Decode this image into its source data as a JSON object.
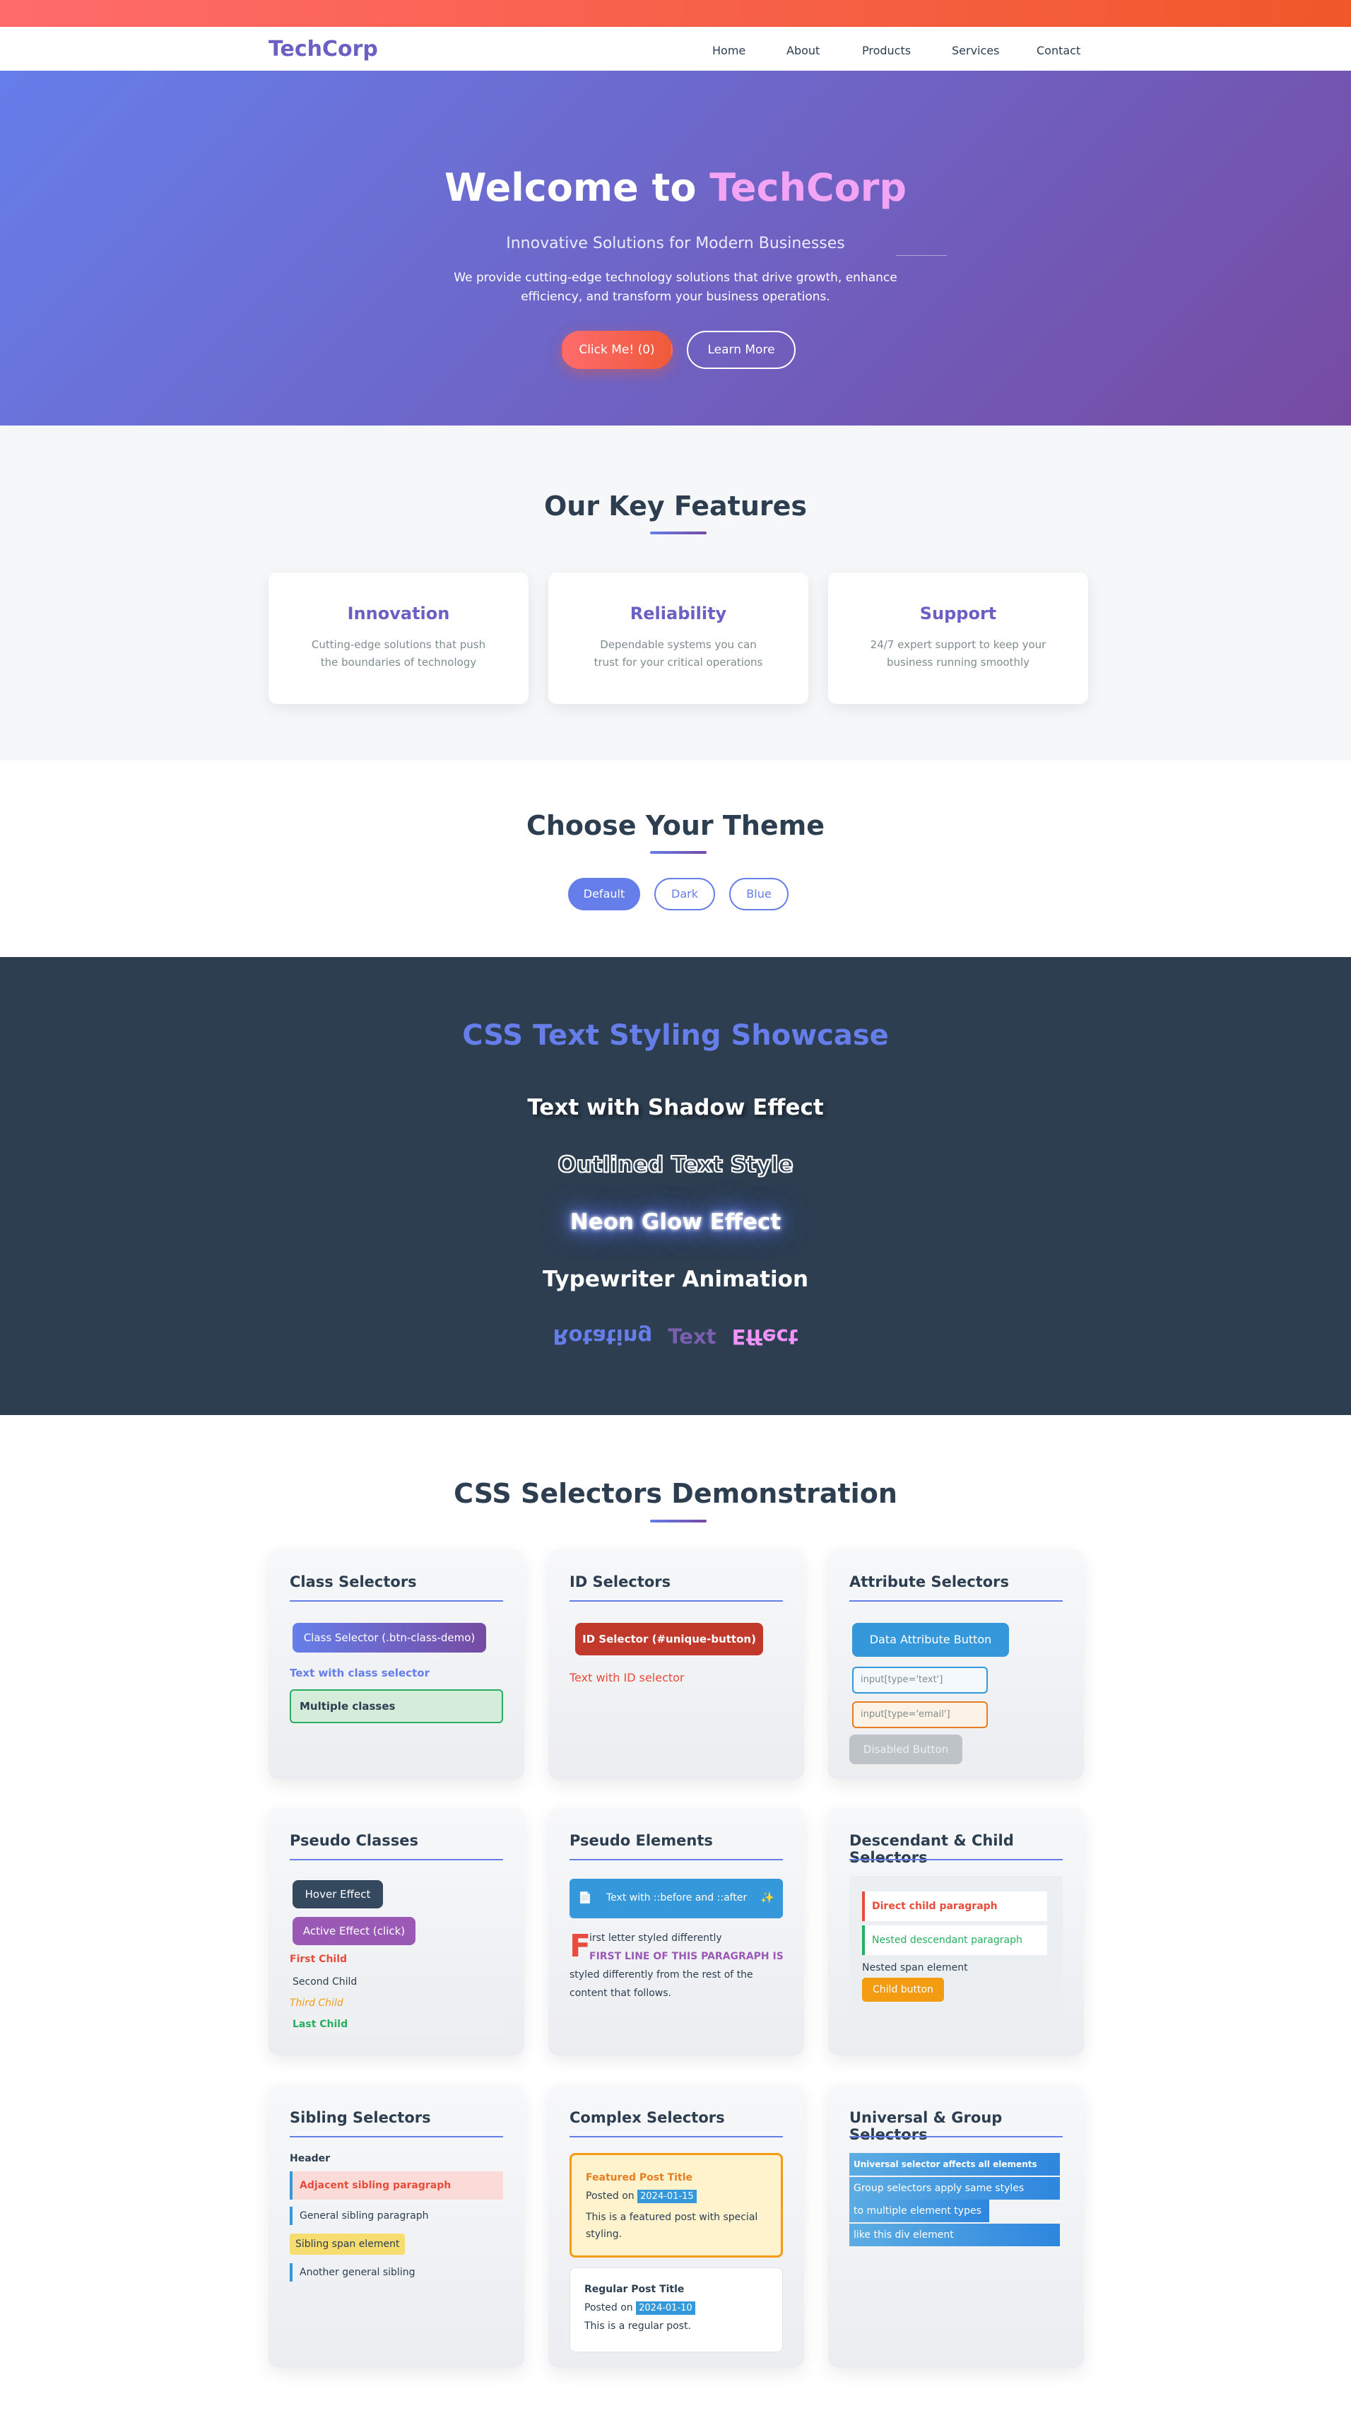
{
  "nav": {
    "logo": "TechCorp",
    "links": [
      "Home",
      "About",
      "Products",
      "Services",
      "Contact"
    ]
  },
  "hero": {
    "title_prefix": "Welcome to ",
    "title_brand": "TechCorp",
    "subtitle": "Innovative Solutions for Modern Businesses",
    "description": "We provide cutting-edge technology solutions that drive growth, enhance efficiency, and transform your business operations.",
    "primary_button": "Click Me! (0)",
    "secondary_button": "Learn More"
  },
  "features": {
    "title": "Our Key Features",
    "cards": [
      {
        "title": "Innovation",
        "text": "Cutting-edge solutions that push the boundaries of technology"
      },
      {
        "title": "Reliability",
        "text": "Dependable systems you can trust for your critical operations"
      },
      {
        "title": "Support",
        "text": "24/7 expert support to keep your business running smoothly"
      }
    ]
  },
  "theme": {
    "title": "Choose Your Theme",
    "buttons": [
      "Default",
      "Dark",
      "Blue"
    ],
    "active": "Default"
  },
  "showcase": {
    "title": "CSS Text Styling Showcase",
    "shadow": "Text with Shadow Effect",
    "outline": "Outlined Text Style",
    "neon": "Neon Glow Effect",
    "typewriter": "Typewriter Animation",
    "rotating": [
      "Rotating",
      "Text",
      "Effect"
    ]
  },
  "selectors": {
    "title": "CSS Selectors Demonstration",
    "class": {
      "title": "Class Selectors",
      "button": "Class Selector (.btn-class-demo)",
      "text": "Text with class selector",
      "multi": "Multiple classes"
    },
    "id": {
      "title": "ID Selectors",
      "button": "ID Selector (#unique-button)",
      "text": "Text with ID selector"
    },
    "attribute": {
      "title": "Attribute Selectors",
      "button": "Data Attribute Button",
      "input_text": "input[type='text']",
      "input_email": "input[type='email']",
      "disabled": "Disabled Button"
    },
    "pseudo_class": {
      "title": "Pseudo Classes",
      "hover": "Hover Effect",
      "active": "Active Effect (click)",
      "first": "First Child",
      "second": "Second Child",
      "third": "Third Child",
      "last": "Last Child"
    },
    "pseudo_element": {
      "title": "Pseudo Elements",
      "banner": "Text with ::before and ::after",
      "dropcap": "F",
      "line1": "irst letter styled differently",
      "line2": "FIRST LINE OF THIS PARAGRAPH IS",
      "line3": "styled differently from the rest of the",
      "line4": "content that follows."
    },
    "descendant": {
      "title": "Descendant & Child Selectors",
      "direct": "Direct child paragraph",
      "nested": "Nested descendant paragraph",
      "span": "Nested span element",
      "button": "Child button"
    },
    "sibling": {
      "title": "Sibling Selectors",
      "header": "Header",
      "adjacent": "Adjacent sibling paragraph",
      "general": "General sibling paragraph",
      "span": "Sibling span element",
      "another": "Another general sibling"
    },
    "complex": {
      "title": "Complex Selectors",
      "featured_title": "Featured Post Title",
      "posted_on": "Posted on",
      "featured_date": "2024-01-15",
      "featured_text": "This is a featured post with special styling.",
      "regular_title": "Regular Post Title",
      "regular_date": "2024-01-10",
      "regular_text": "This is a regular post."
    },
    "universal": {
      "title": "Universal & Group Selectors",
      "line1": "Universal selector affects all elements",
      "line2": "Group selectors apply same styles",
      "line3": "to multiple element types",
      "line4": "like this div element"
    }
  },
  "colors": {
    "primary": "#667eea",
    "secondary": "#764ba2",
    "accent": "#ff6b6b",
    "dark": "#2c3e50"
  }
}
